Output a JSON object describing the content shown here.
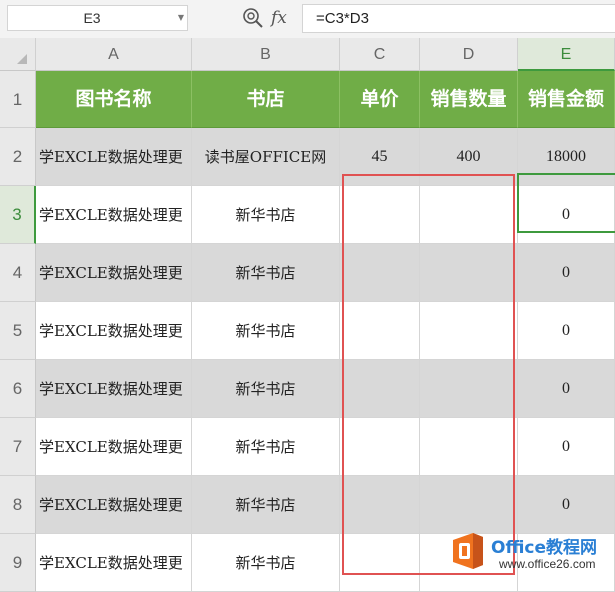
{
  "formula_bar": {
    "name_box": "E3",
    "formula": "=C3*D3",
    "zoom_icon": "magnifier-zoom-icon",
    "fx_label": "fx"
  },
  "columns": [
    "A",
    "B",
    "C",
    "D",
    "E"
  ],
  "rows": [
    "1",
    "2",
    "3",
    "4",
    "5",
    "6",
    "7",
    "8",
    "9"
  ],
  "header_row": [
    "图书名称",
    "书店",
    "单价",
    "销售数量",
    "销售金额"
  ],
  "data_rows": [
    {
      "name": "学EXCLE数据处理更",
      "store": "读书屋OFFICE网",
      "price": "45",
      "qty": "400",
      "amount": "18000"
    },
    {
      "name": "学EXCLE数据处理更",
      "store": "新华书店",
      "price": "",
      "qty": "",
      "amount": "0"
    },
    {
      "name": "学EXCLE数据处理更",
      "store": "新华书店",
      "price": "",
      "qty": "",
      "amount": "0"
    },
    {
      "name": "学EXCLE数据处理更",
      "store": "新华书店",
      "price": "",
      "qty": "",
      "amount": "0"
    },
    {
      "name": "学EXCLE数据处理更",
      "store": "新华书店",
      "price": "",
      "qty": "",
      "amount": "0"
    },
    {
      "name": "学EXCLE数据处理更",
      "store": "新华书店",
      "price": "",
      "qty": "",
      "amount": "0"
    },
    {
      "name": "学EXCLE数据处理更",
      "store": "新华书店",
      "price": "",
      "qty": "",
      "amount": "0"
    },
    {
      "name": "学EXCLE数据处理更",
      "store": "新华书店",
      "price": "",
      "qty": "",
      "amount": ""
    }
  ],
  "selection": {
    "active_cell": "E3",
    "highlight_range": "C3:D9"
  },
  "colors": {
    "header_fill": "#70ad47",
    "stripe_fill": "#d9d9d9",
    "selection_green": "#3e9a3e",
    "highlight_red": "#e05252"
  },
  "watermark": {
    "title_prefix": "Office",
    "title_suffix": "教程网",
    "url": "www.office26.com"
  }
}
